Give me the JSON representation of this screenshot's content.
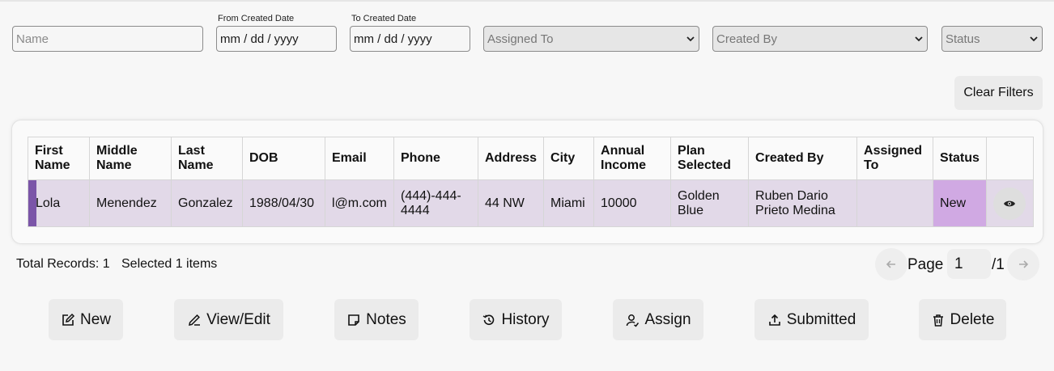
{
  "filters": {
    "name_placeholder": "Name",
    "from_label": "From Created Date",
    "from_value": "mm / dd / yyyy",
    "to_label": "To Created Date",
    "to_value": "mm / dd / yyyy",
    "assigned_to": "Assigned To",
    "created_by": "Created By",
    "status": "Status",
    "clear_label": "Clear Filters"
  },
  "table": {
    "headers": {
      "first_name": "First Name",
      "middle_name": "Middle Name",
      "last_name": "Last Name",
      "dob": "DOB",
      "email": "Email",
      "phone": "Phone",
      "address": "Address",
      "city": "City",
      "annual_income": "Annual Income",
      "plan_selected": "Plan Selected",
      "created_by": "Created By",
      "assigned_to": "Assigned To",
      "status": "Status"
    },
    "rows": [
      {
        "first_name": "Lola",
        "middle_name": "Menendez",
        "last_name": "Gonzalez",
        "dob": "1988/04/30",
        "email": "l@m.com",
        "phone": "(444)-444-4444",
        "address": "44 NW",
        "city": "Miami",
        "annual_income": "10000",
        "plan_selected": "Golden Blue",
        "created_by": "Ruben Dario Prieto Medina",
        "assigned_to": "",
        "status": "New",
        "action_icon": "eye-icon"
      }
    ]
  },
  "summary": {
    "total_records": "Total Records: 1",
    "selected": "Selected 1 items"
  },
  "pagination": {
    "label": "Page",
    "current": "1",
    "total": "/1"
  },
  "actions": {
    "new": "New",
    "view_edit": "View/Edit",
    "notes": "Notes",
    "history": "History",
    "assign": "Assign",
    "submitted": "Submitted",
    "delete": "Delete"
  },
  "colors": {
    "row_bg": "#e2d9e8",
    "row_marker": "#7b55a8",
    "status_new": "#d0a9e3"
  }
}
